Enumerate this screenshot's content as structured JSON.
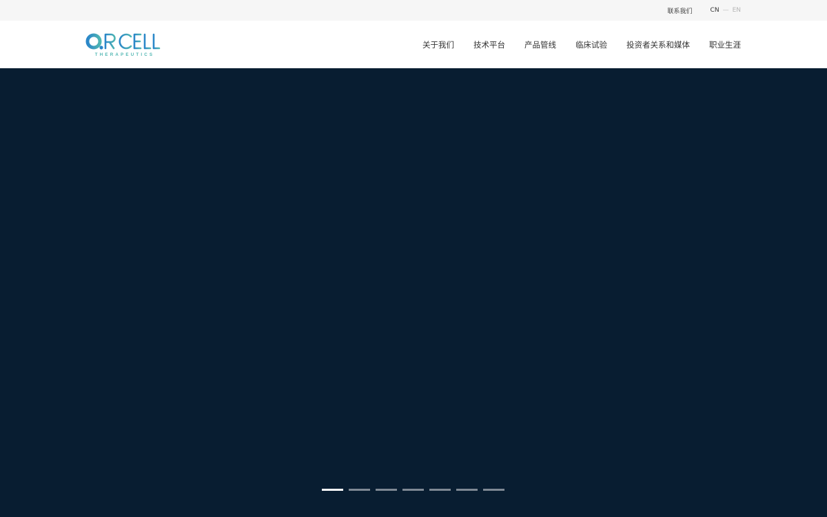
{
  "topbar": {
    "contact_label": "联系我们",
    "lang_cn": "CN",
    "lang_separator": "—",
    "lang_en": "EN"
  },
  "logo": {
    "wordmark": "ORICELL",
    "tagline": "THERAPEUTICS",
    "colors": {
      "primary": "#2a86c9",
      "secondary": "#4fb6b2"
    }
  },
  "nav": {
    "items": [
      {
        "label": "关于我们"
      },
      {
        "label": "技术平台"
      },
      {
        "label": "产品管线"
      },
      {
        "label": "临床试验"
      },
      {
        "label": "投资者关系和媒体"
      },
      {
        "label": "职业生涯"
      }
    ]
  },
  "hero": {
    "background_color": "#081d31",
    "slides_total": 7,
    "active_slide": 1
  },
  "colors": {
    "topbar_bg": "#f6f6f6",
    "header_bg": "#ffffff",
    "hero_bg": "#081d31",
    "dot_active": "#ffffff",
    "dot_inactive": "#7f8994"
  }
}
